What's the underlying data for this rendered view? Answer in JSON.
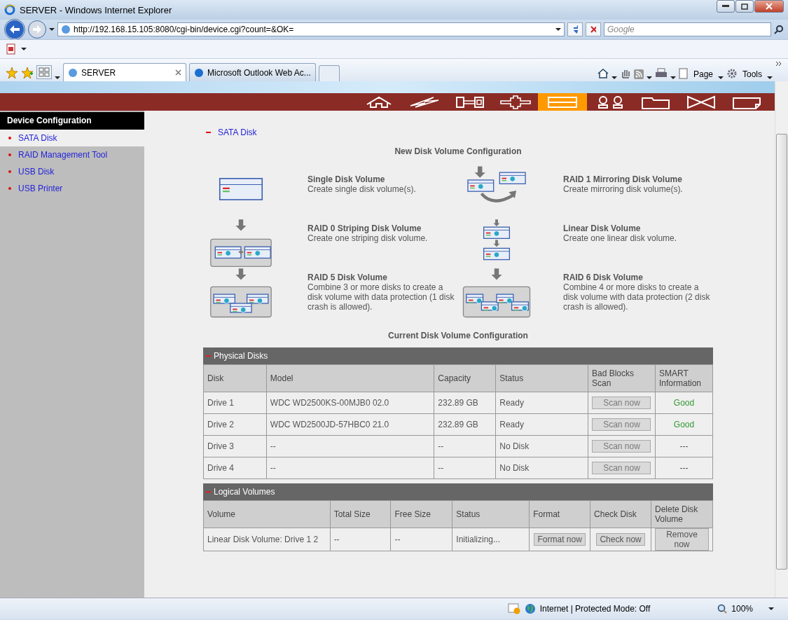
{
  "window": {
    "title": "SERVER - Windows Internet Explorer"
  },
  "address_bar": {
    "url": "http://192.168.15.105:8080/cgi-bin/device.cgi?count=&OK=",
    "search_placeholder": "Google"
  },
  "tabs": [
    {
      "label": "SERVER",
      "selected": true
    },
    {
      "label": "Microsoft Outlook Web Ac...",
      "selected": false
    }
  ],
  "command_bar": {
    "items": [
      "Page",
      "Tools"
    ]
  },
  "nav_icons": [
    {
      "kind": "home",
      "selected": false
    },
    {
      "kind": "lightning",
      "selected": false
    },
    {
      "kind": "key",
      "selected": false
    },
    {
      "kind": "connector",
      "selected": false
    },
    {
      "kind": "drive",
      "selected": true
    },
    {
      "kind": "users",
      "selected": false
    },
    {
      "kind": "folder",
      "selected": false
    },
    {
      "kind": "bowtie",
      "selected": false
    },
    {
      "kind": "note",
      "selected": false
    }
  ],
  "sidebar": {
    "title": "Device Configuration",
    "items": [
      {
        "label": "SATA Disk",
        "selected": true
      },
      {
        "label": "RAID Management Tool",
        "selected": false
      },
      {
        "label": "USB Disk",
        "selected": false
      },
      {
        "label": "USB Printer",
        "selected": false
      }
    ]
  },
  "section_title": "SATA Disk",
  "new_config": {
    "title": "New Disk Volume Configuration",
    "options": [
      {
        "kind": "single",
        "title": "Single Disk Volume",
        "description": "Create single disk volume(s)."
      },
      {
        "kind": "raid1",
        "title": "RAID 1 Mirroring Disk Volume",
        "description": "Create mirroring disk volume(s)."
      },
      {
        "kind": "raid0",
        "title": "RAID 0 Striping Disk Volume",
        "description": "Create one striping disk volume."
      },
      {
        "kind": "linear",
        "title": "Linear Disk Volume",
        "description": "Create one linear disk volume."
      },
      {
        "kind": "raid5",
        "title": "RAID 5 Disk Volume",
        "description": "Combine 3 or more disks to create a disk volume with data protection (1 disk crash is allowed)."
      },
      {
        "kind": "raid6",
        "title": "RAID 6 Disk Volume",
        "description": "Combine 4 or more disks to create a disk volume with data protection (2 disk crash is allowed)."
      }
    ]
  },
  "current_config": {
    "title": "Current Disk Volume Configuration",
    "physical_disks": {
      "title": "Physical Disks",
      "columns": [
        "Disk",
        "Model",
        "Capacity",
        "Status",
        "Bad Blocks Scan",
        "SMART Information"
      ],
      "rows": [
        {
          "disk": "Drive 1",
          "model": "WDC WD2500KS-00MJB0 02.0",
          "capacity": "232.89 GB",
          "status": "Ready",
          "scan": {
            "label": "Scan now",
            "disabled": true
          },
          "smart": {
            "text": "Good",
            "color": "#339933"
          }
        },
        {
          "disk": "Drive 2",
          "model": "WDC WD2500JD-57HBC0 21.0",
          "capacity": "232.89 GB",
          "status": "Ready",
          "scan": {
            "label": "Scan now",
            "disabled": true
          },
          "smart": {
            "text": "Good",
            "color": "#339933"
          }
        },
        {
          "disk": "Drive 3",
          "model": "--",
          "capacity": "--",
          "status": "No Disk",
          "scan": {
            "label": "Scan now",
            "disabled": true
          },
          "smart": {
            "text": "---",
            "color": "#555555"
          }
        },
        {
          "disk": "Drive 4",
          "model": "--",
          "capacity": "--",
          "status": "No Disk",
          "scan": {
            "label": "Scan now",
            "disabled": true
          },
          "smart": {
            "text": "---",
            "color": "#555555"
          }
        }
      ]
    },
    "logical_volumes": {
      "title": "Logical Volumes",
      "columns": [
        "Volume",
        "Total Size",
        "Free Size",
        "Status",
        "Format",
        "Check Disk",
        "Delete Disk Volume"
      ],
      "rows": [
        {
          "volume": "Linear Disk Volume: Drive 1 2",
          "total": "--",
          "free": "--",
          "status": "Initializing...",
          "buttons": [
            {
              "label": "Format now",
              "disabled": false
            },
            {
              "label": "Check now",
              "disabled": false
            },
            {
              "label": "Remove now",
              "disabled": false
            }
          ]
        }
      ]
    }
  },
  "status_bar": {
    "zone": "Internet | Protected Mode: Off",
    "zoom": "100%"
  }
}
